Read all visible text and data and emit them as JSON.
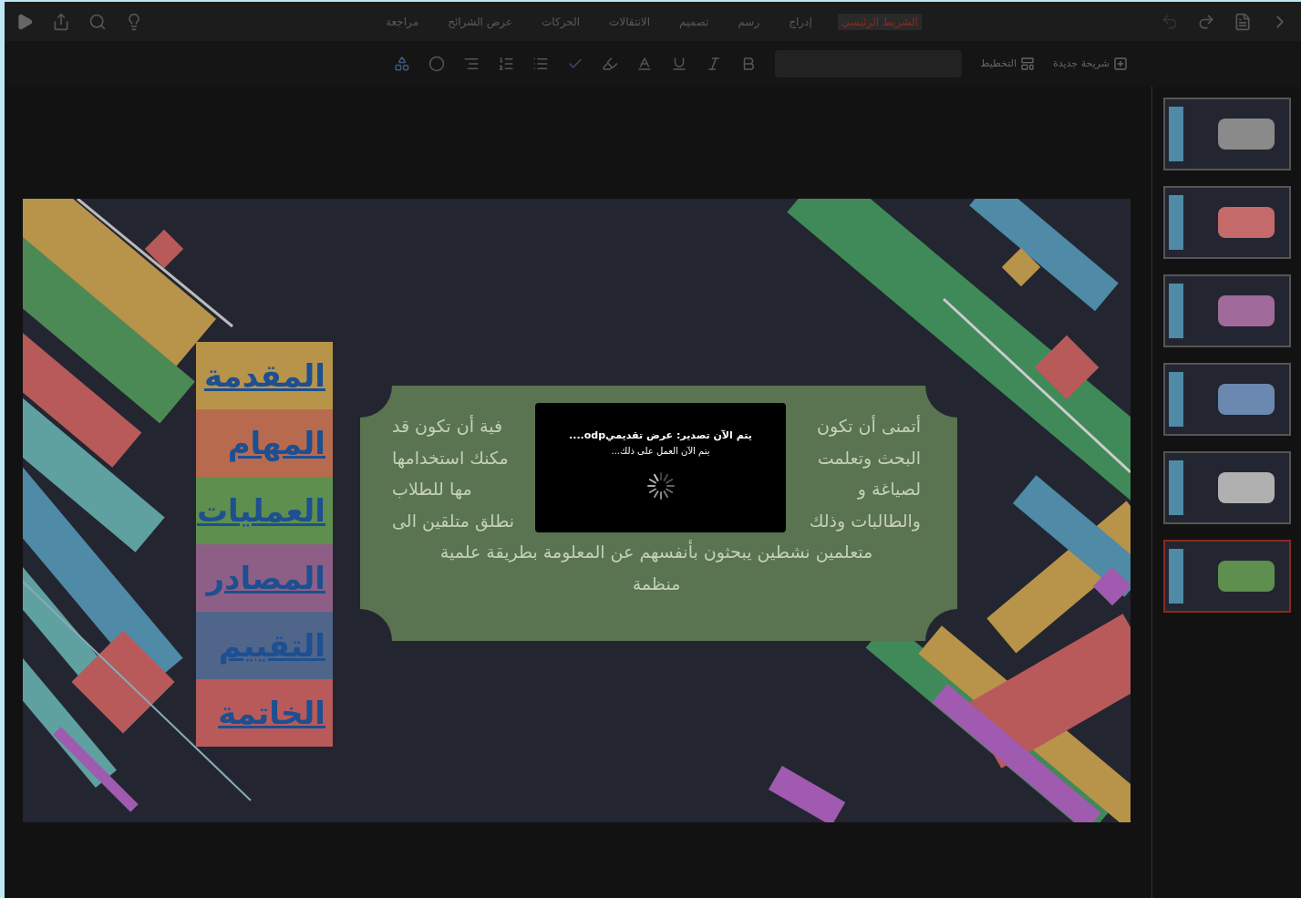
{
  "ribbon_tabs": [
    {
      "label": "الشريط الرئيسي",
      "selected": true
    },
    {
      "label": "إدراج",
      "selected": false
    },
    {
      "label": "رسم",
      "selected": false
    },
    {
      "label": "تصميم",
      "selected": false
    },
    {
      "label": "الانتقالات",
      "selected": false
    },
    {
      "label": "الحركات",
      "selected": false
    },
    {
      "label": "عرض الشرائح",
      "selected": false
    },
    {
      "label": "مراجعة",
      "selected": false
    }
  ],
  "toolbar": {
    "new_slide": "شريحة جديدة",
    "layout": "التخطيط"
  },
  "slide": {
    "menu": [
      {
        "label": "المقدمة",
        "color": "#b8934a"
      },
      {
        "label": "المهام",
        "color": "#b86a4f"
      },
      {
        "label": "العمليات",
        "color": "#5f8f4e"
      },
      {
        "label": "المصادر",
        "color": "#8e5f86"
      },
      {
        "label": "التقييم",
        "color": "#50658a"
      },
      {
        "label": "الخاتمة",
        "color": "#b85a5a"
      }
    ],
    "text_lines": [
      {
        "right": "أتمنى أن تكون",
        "left": "فية أن تكون قد"
      },
      {
        "right": "البحث وتعلمت",
        "left": "مكنك استخدامها"
      },
      {
        "right": "لصياغة و",
        "left": "مها للطلاب"
      },
      {
        "right": "والطالبات وذلك",
        "left": "نطلق متلقين الى"
      },
      {
        "right": "متعلمين نشطين يبحثون بأنفسهم عن المعلومة بطريقة علمية"
      },
      {
        "right": "منظمة"
      }
    ]
  },
  "dialog": {
    "title": "يتم الآن تصدير: عرض تقديميodp....",
    "message": "يتم الآن العمل على ذلك..."
  },
  "thumbnails": [
    {
      "selected": false,
      "color": "#8a8a8a"
    },
    {
      "selected": false,
      "color": "#c46a6a"
    },
    {
      "selected": false,
      "color": "#a06a9a"
    },
    {
      "selected": false,
      "color": "#6a88b0"
    },
    {
      "selected": false,
      "color": "#b0b0b0"
    },
    {
      "selected": true,
      "color": "#5f8f4e"
    }
  ]
}
